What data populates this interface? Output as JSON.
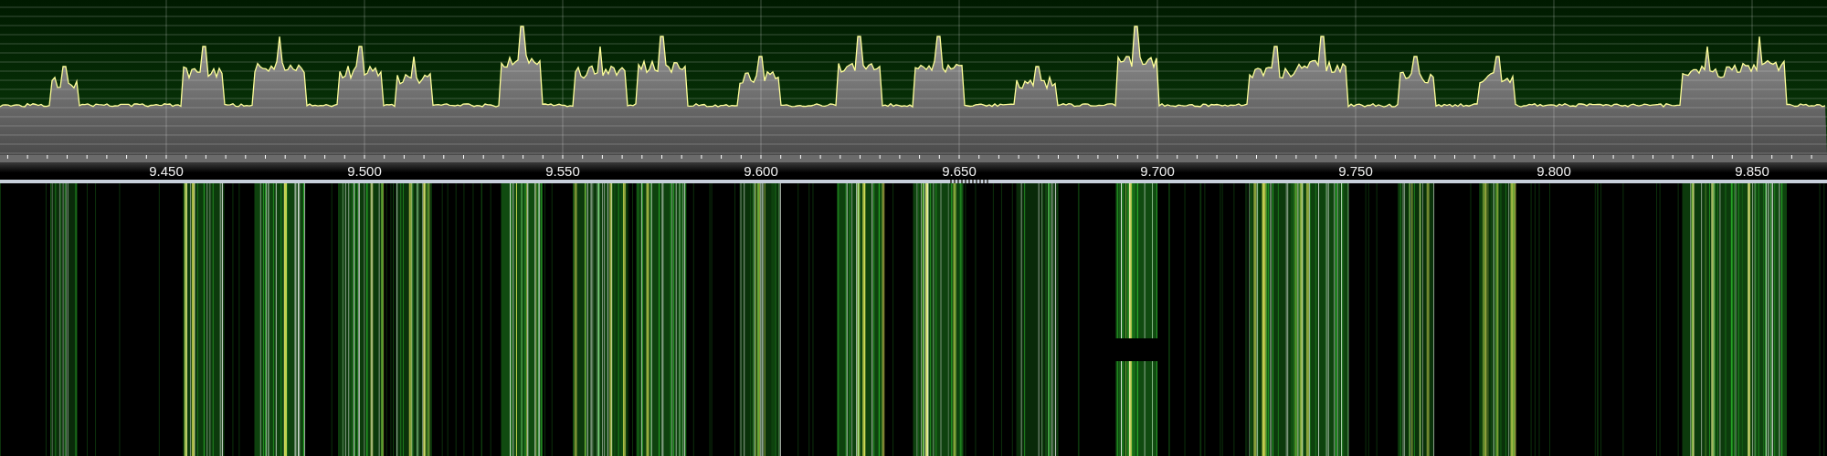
{
  "frequency_axis": {
    "labels": [
      "9.450",
      "9.500",
      "9.550",
      "9.600",
      "9.650",
      "9.700",
      "9.750",
      "9.800",
      "9.850"
    ]
  }
}
